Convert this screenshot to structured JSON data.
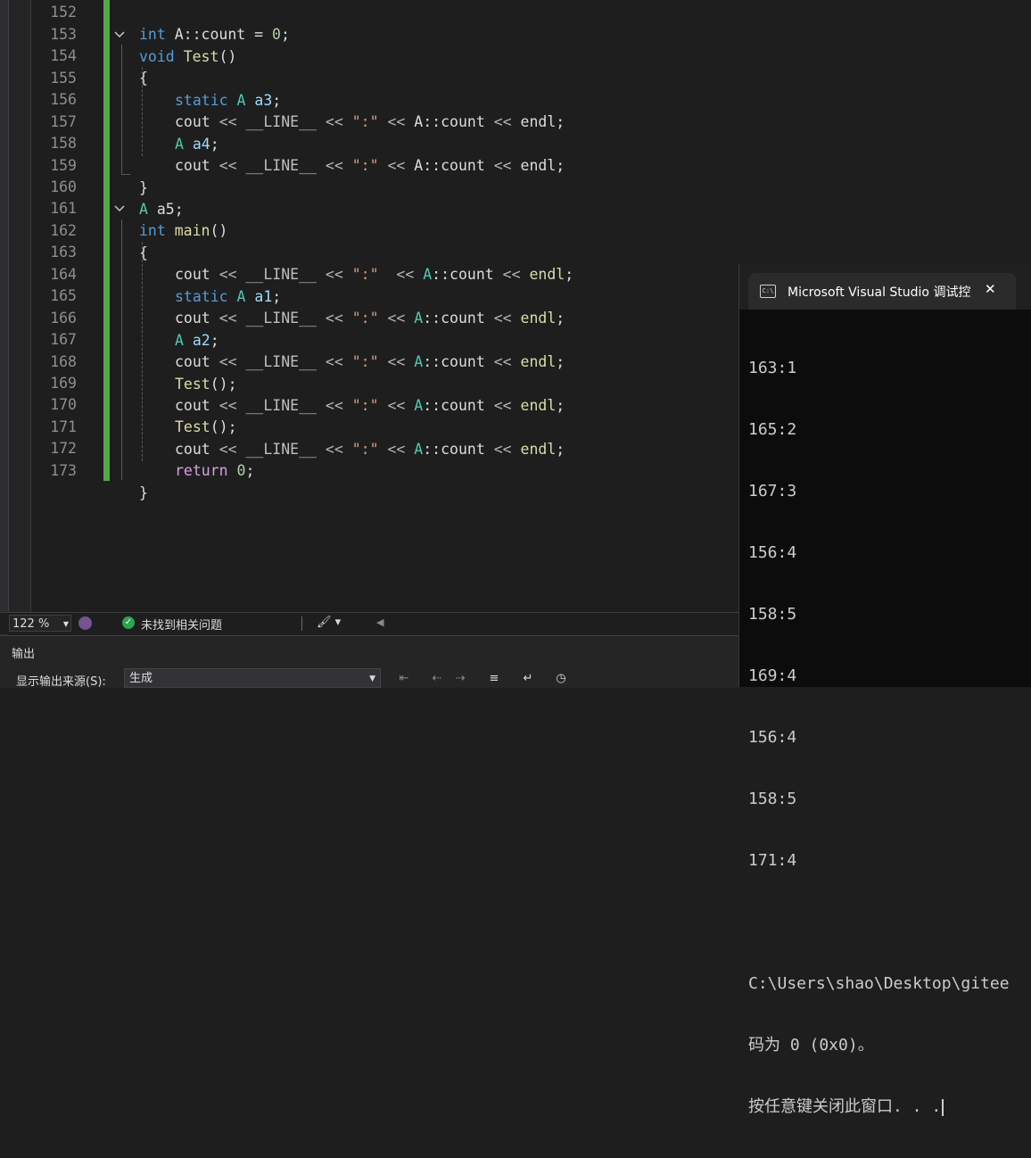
{
  "editor": {
    "lines": [
      {
        "num": "152",
        "code": [
          [
            "",
            "int",
            "kw"
          ],
          [
            " A::count = ",
            "",
            ""
          ],
          [
            "0",
            "num"
          ],
          [
            ";",
            ""
          ]
        ]
      },
      {
        "num": "153"
      },
      {
        "num": "154"
      },
      {
        "num": "155"
      },
      {
        "num": "156"
      },
      {
        "num": "157"
      },
      {
        "num": "158"
      },
      {
        "num": "159"
      },
      {
        "num": "160"
      },
      {
        "num": "161"
      },
      {
        "num": "162"
      },
      {
        "num": "163"
      },
      {
        "num": "164"
      },
      {
        "num": "165"
      },
      {
        "num": "166"
      },
      {
        "num": "167"
      },
      {
        "num": "168"
      },
      {
        "num": "169"
      },
      {
        "num": "170"
      },
      {
        "num": "171"
      },
      {
        "num": "172"
      },
      {
        "num": "173"
      }
    ],
    "tokens": {
      "int": "int",
      "void": "void",
      "static": "static",
      "return": "return",
      "A": "A",
      "Test": "Test",
      "main": "main",
      "cout": "cout",
      "endl": "endl",
      "LINE": "__LINE__",
      "shl": "<<",
      "colon_str": "\":\"",
      "count_scope": "A::",
      "count": "count",
      "a1": "a1",
      "a2": "a2",
      "a3": "a3",
      "a4": "a4",
      "a5": "a5",
      "zero": "0",
      "assign_count": " A::count = ",
      "parens": "()",
      "semi": ";",
      "lbrace": "{",
      "rbrace": "}"
    }
  },
  "status": {
    "zoom": "122 %",
    "issues": "未找到相关问题"
  },
  "output": {
    "title": "输出",
    "source_label": "显示输出来源(S):",
    "source_value": "生成"
  },
  "console": {
    "title": "Microsoft Visual Studio 调试控",
    "lines": [
      "163:1",
      "165:2",
      "167:3",
      "156:4",
      "158:5",
      "169:4",
      "156:4",
      "158:5",
      "171:4",
      "",
      "C:\\Users\\shao\\Desktop\\gitee",
      "码为 0 (0x0)。",
      "按任意键关闭此窗口. . ."
    ]
  },
  "colors": {
    "keyword": "#569cd6",
    "type": "#4ec9b0",
    "function": "#dcdcaa",
    "string": "#d69d85",
    "number": "#b5cea8",
    "variable": "#9cdcfe",
    "change_bar": "#57a64a"
  }
}
